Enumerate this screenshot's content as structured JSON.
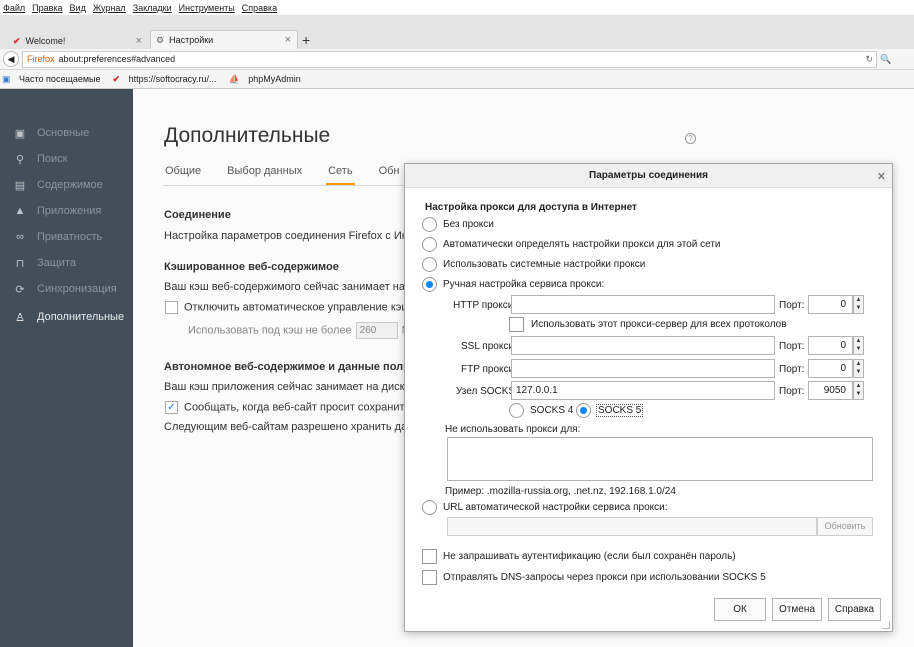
{
  "menubar": {
    "items": [
      "Файл",
      "Правка",
      "Вид",
      "Журнал",
      "Закладки",
      "Инструменты",
      "Справка"
    ]
  },
  "tabs": [
    {
      "label": "Welcome!"
    },
    {
      "label": "Настройки"
    }
  ],
  "navbar": {
    "identity": "Firefox",
    "url": "about:preferences#advanced"
  },
  "bookmarks": [
    {
      "label": "Часто посещаемые"
    },
    {
      "label": "https://softocracy.ru/..."
    },
    {
      "label": "phpMyAdmin"
    }
  ],
  "sidebar": {
    "items": [
      {
        "label": "Основные",
        "icon": "general-icon"
      },
      {
        "label": "Поиск",
        "icon": "search-icon"
      },
      {
        "label": "Содержимое",
        "icon": "content-icon"
      },
      {
        "label": "Приложения",
        "icon": "applications-icon"
      },
      {
        "label": "Приватность",
        "icon": "privacy-mask-icon"
      },
      {
        "label": "Защита",
        "icon": "lock-icon"
      },
      {
        "label": "Синхронизация",
        "icon": "sync-icon"
      },
      {
        "label": "Дополнительные",
        "icon": "advanced-icon"
      }
    ]
  },
  "page": {
    "title": "Дополнительные",
    "subtabs": [
      "Общие",
      "Выбор данных",
      "Сеть",
      "Обн"
    ],
    "connection_heading": "Соединение",
    "connection_text": "Настройка параметров соединения Firefox с Интер",
    "cache_heading": "Кэшированное веб-содержимое",
    "cache_text": "Ваш кэш веб-содержимого сейчас занимает на дис",
    "cache_override": "Отключить автоматическое управление кэшем",
    "cache_limit_label": "Использовать под кэш не более",
    "cache_limit_value": "260",
    "cache_limit_unit": "М",
    "offline_heading": "Автономное веб-содержимое и данные польз",
    "offline_text": "Ваш кэш приложения сейчас занимает на диске 0 б",
    "offline_notify": "Сообщать, когда веб-сайт просит сохранить да",
    "offline_list": "Следующим веб-сайтам разрешено хранить данны"
  },
  "dialog": {
    "title": "Параметры соединения",
    "heading": "Настройка прокси для доступа в Интернет",
    "options": [
      "Без прокси",
      "Автоматически определять настройки прокси для этой сети",
      "Использовать системные настройки прокси",
      "Ручная настройка сервиса прокси:"
    ],
    "selected_option": 3,
    "http_label": "HTTP прокси:",
    "http_value": "",
    "http_port": "0",
    "port_label": "Порт:",
    "share_label": "Использовать этот прокси-сервер для всех протоколов",
    "ssl_label": "SSL прокси:",
    "ssl_value": "",
    "ssl_port": "0",
    "ftp_label": "FTP прокси:",
    "ftp_value": "",
    "ftp_port": "0",
    "socks_label": "Узел SOCKS:",
    "socks_value": "127.0.0.1",
    "socks_port": "9050",
    "socks4": "SOCKS 4",
    "socks5": "SOCKS 5",
    "socks_selected": "SOCKS 5",
    "noproxy_label": "Не использовать прокси для:",
    "noproxy_value": "",
    "example": "Пример: .mozilla-russia.org, .net.nz, 192.168.1.0/24",
    "autourl_label": "URL автоматической настройки сервиса прокси:",
    "reload_label": "Обновить",
    "noauth_label": "Не запрашивать аутентификацию (если был сохранён пароль)",
    "dns_label": "Отправлять DNS-запросы через прокси при использовании SOCKS 5",
    "ok": "ОК",
    "cancel": "Отмена",
    "help": "Справка"
  },
  "colors": {
    "sidebar": "#424f5a",
    "accent": "#0a84ff",
    "tab_underline": "#ff9500",
    "firefox": "#e66000"
  }
}
